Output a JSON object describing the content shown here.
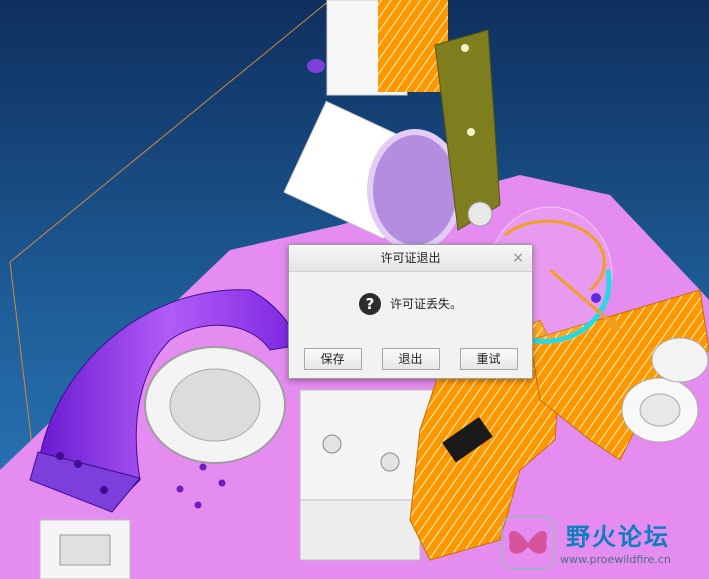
{
  "dialog": {
    "title": "许可证退出",
    "close_glyph": "×",
    "icon": "question-icon",
    "icon_glyph": "?",
    "message": "许可证丢失。",
    "buttons": {
      "save": "保存",
      "exit": "退出",
      "retry": "重试"
    }
  },
  "watermark": {
    "title": "野火论坛",
    "url": "www.proewildfire.cn"
  },
  "colors": {
    "background_top": "#0f2f5e",
    "background_bottom": "#2d7cbf",
    "plate": "#e58cf0",
    "bracket": "#8a2be2",
    "section_hatch": "#ff9800",
    "arm": "#7e7e1e"
  }
}
